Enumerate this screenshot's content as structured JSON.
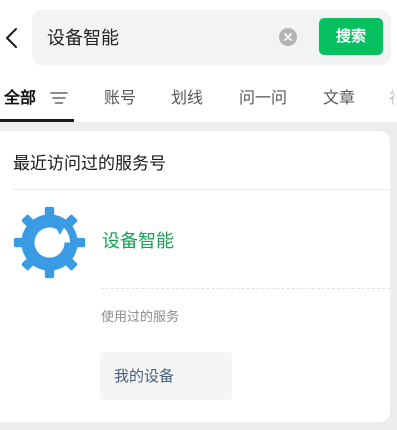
{
  "search": {
    "query": "设备智能",
    "button_label": "搜索"
  },
  "tabs": [
    {
      "label": "全部"
    },
    {
      "label": "账号"
    },
    {
      "label": "划线"
    },
    {
      "label": "问一问"
    },
    {
      "label": "文章"
    },
    {
      "label": "视"
    }
  ],
  "recent_section": {
    "title": "最近访问过的服务号",
    "account": {
      "name": "设备智能",
      "avatar_icon": "refresh-gear-icon",
      "avatar_color": "#3a9be5"
    },
    "used_services_title": "使用过的服务",
    "services": [
      {
        "label": "我的设备"
      }
    ]
  },
  "colors": {
    "accent_green": "#07c160",
    "account_name_green": "#19a257",
    "service_link_blue": "#465d7e"
  }
}
